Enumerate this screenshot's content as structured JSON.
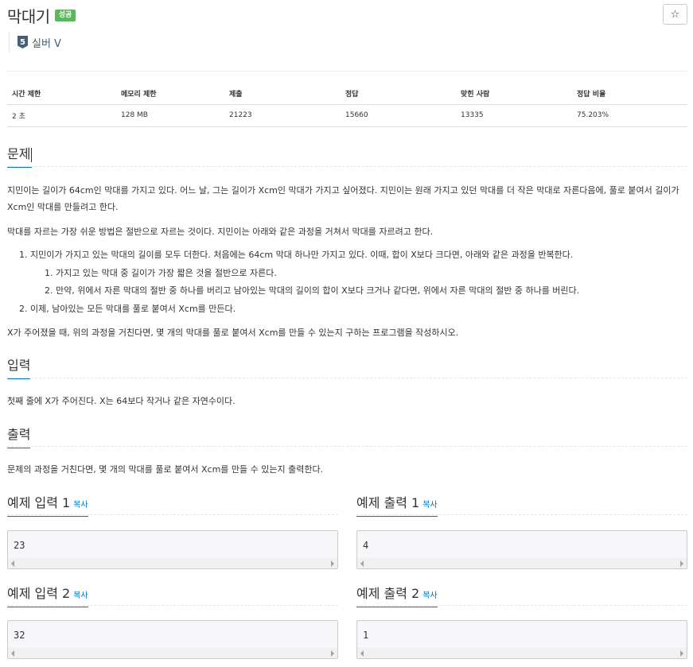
{
  "problem": {
    "title": "막대기",
    "status_badge": "성공",
    "star_icon": "☆",
    "tier": {
      "icon_number": "5",
      "label": "실버 V",
      "color": "#435f7a"
    }
  },
  "info_table": {
    "headers": [
      "시간 제한",
      "메모리 제한",
      "제출",
      "정답",
      "맞힌 사람",
      "정답 비율"
    ],
    "values": [
      "2 초",
      "128 MB",
      "21223",
      "15660",
      "13335",
      "75.203%"
    ]
  },
  "sections": {
    "problem": {
      "heading": "문제",
      "paragraphs": [
        "지민이는 길이가 64cm인 막대를 가지고 있다. 어느 날, 그는 길이가 Xcm인 막대가 가지고 싶어졌다. 지민이는 원래 가지고 있던 막대를 더 작은 막대로 자른다음에, 풀로 붙여서 길이가 Xcm인 막대를 만들려고 한다.",
        "막대를 자르는 가장 쉬운 방법은 절반으로 자르는 것이다. 지민이는 아래와 같은 과정을 거쳐서 막대를 자르려고 한다.",
        "X가 주어졌을 때, 위의 과정을 거친다면, 몇 개의 막대를 풀로 붙여서 Xcm를 만들 수 있는지 구하는 프로그램을 작성하시오."
      ],
      "list": {
        "item1": "1. 지민이가 가지고 있는 막대의 길이를 모두 더한다. 처음에는 64cm 막대 하나만 가지고 있다. 이때, 합이 X보다 크다면, 아래와 같은 과정을 반복한다.",
        "item1_sub1": "1. 가지고 있는 막대 중 길이가 가장 짧은 것을 절반으로 자른다.",
        "item1_sub2": "2. 만약, 위에서 자른 막대의 절반 중 하나를 버리고 남아있는 막대의 길이의 합이 X보다 크거나 같다면, 위에서 자른 막대의 절반 중 하나를 버린다.",
        "item2": "2. 이제, 남아있는 모든 막대를 풀로 붙여서 Xcm를 만든다."
      }
    },
    "input": {
      "heading": "입력",
      "text": "첫째 줄에 X가 주어진다. X는 64보다 작거나 같은 자연수이다."
    },
    "output": {
      "heading": "출력",
      "text": "문제의 과정을 거친다면, 몇 개의 막대를 풀로 붙여서 Xcm를 만들 수 있는지 출력한다."
    }
  },
  "samples": {
    "copy_label": "복사",
    "input1": {
      "title": "예제 입력 1",
      "value": "23"
    },
    "output1": {
      "title": "예제 출력 1",
      "value": "4"
    },
    "input2": {
      "title": "예제 입력 2",
      "value": "32"
    },
    "output2": {
      "title": "예제 출력 2",
      "value": "1"
    }
  },
  "colors": {
    "accent": "#0076c0",
    "success": "#5cb85c"
  }
}
